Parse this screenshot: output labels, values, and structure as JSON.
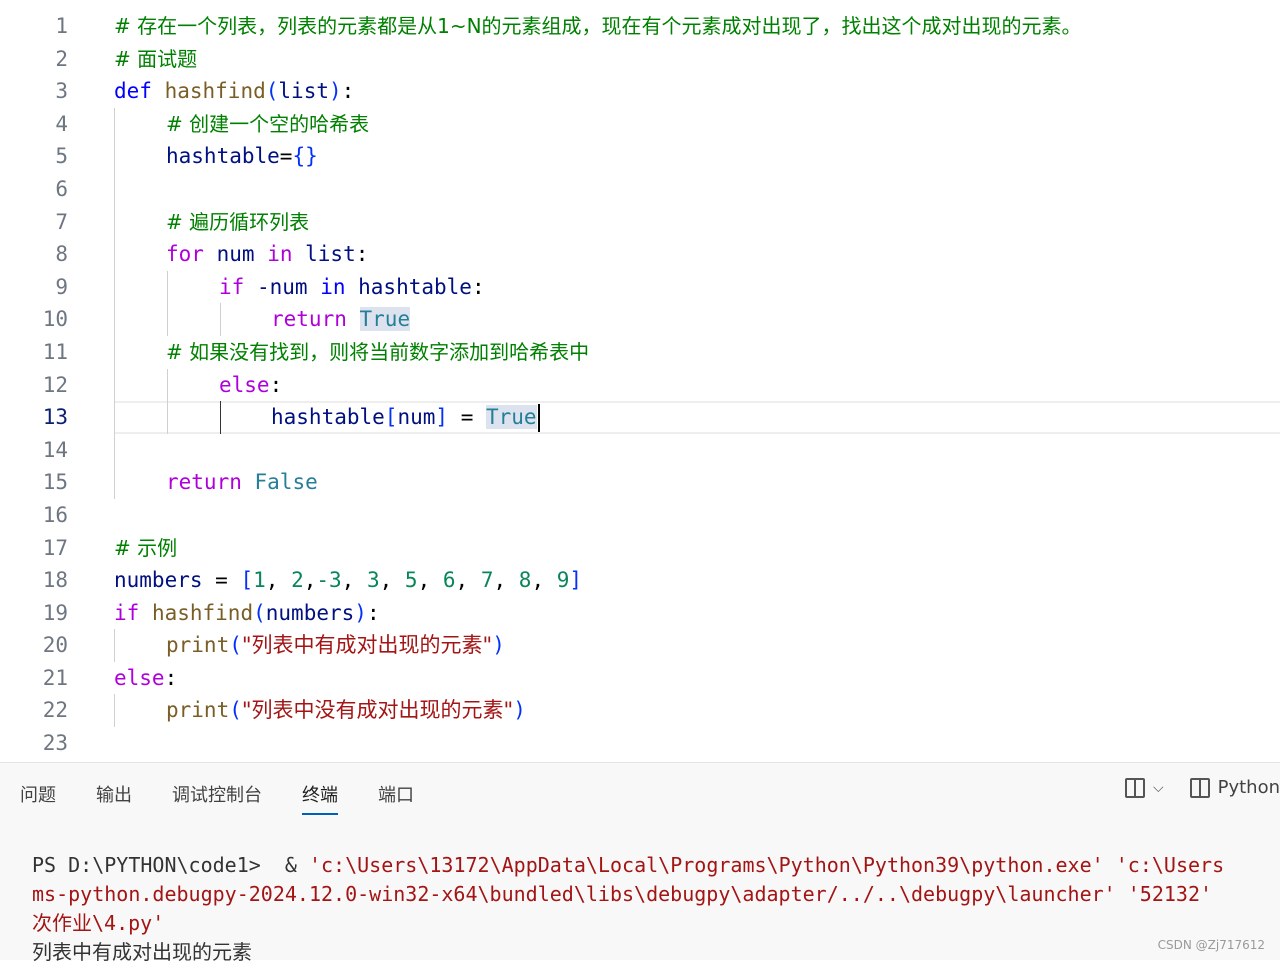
{
  "editor": {
    "active_line": 13,
    "line_numbers": [
      "1",
      "2",
      "3",
      "4",
      "5",
      "6",
      "7",
      "8",
      "9",
      "10",
      "11",
      "12",
      "13",
      "14",
      "15",
      "16",
      "17",
      "18",
      "19",
      "20",
      "21",
      "22",
      "23"
    ],
    "l1_comment": "# 存在一个列表，列表的元素都是从1~N的元素组成，现在有个元素成对出现了，找出这个成对出现的元素。",
    "l2_comment": "# 面试题",
    "l3_def": "def",
    "l3_fn": "hashfind",
    "l3_param": "list",
    "l4_comment": "# 创建一个空的哈希表",
    "l5_var": "hashtable",
    "l7_comment": "# 遍历循环列表",
    "l8_for": "for",
    "l8_var": "num",
    "l8_in": "in",
    "l8_iter": "list",
    "l9_if": "if",
    "l9_expr": "-num",
    "l9_in": "in",
    "l9_target": "hashtable",
    "l10_return": "return",
    "l10_value": "True",
    "l11_comment": "# 如果没有找到，则将当前数字添加到哈希表中",
    "l12_else": "else",
    "l13_target": "hashtable",
    "l13_index": "num",
    "l13_value": "True",
    "l15_return": "return",
    "l15_value": "False",
    "l17_comment": "# 示例",
    "l18_var": "numbers",
    "l18_list": [
      "1",
      "2",
      "-3",
      "3",
      "5",
      "6",
      "7",
      "8",
      "9"
    ],
    "l19_if": "if",
    "l19_fn": "hashfind",
    "l19_arg": "numbers",
    "l20_fn": "print",
    "l20_str": "\"列表中有成对出现的元素\"",
    "l21_else": "else",
    "l22_fn": "print",
    "l22_str": "\"列表中没有成对出现的元素\""
  },
  "panel": {
    "tabs": [
      "问题",
      "输出",
      "调试控制台",
      "终端",
      "端口"
    ],
    "active_tab": "终端",
    "layout_icon": "split-panel-icon",
    "terminal_profile": "Python"
  },
  "terminal": {
    "prompt": "PS D:\\PYTHON\\code1>",
    "amp": "&",
    "exe": "'c:\\Users\\13172\\AppData\\Local\\Programs\\Python\\Python39\\python.exe'",
    "arg1": "'c:\\Users",
    "line2_path": "ms-python.debugpy-2024.12.0-win32-x64\\bundled\\libs\\debugpy\\adapter/../..\\debugpy\\launcher'",
    "line2_port": "'52132'",
    "line3_prefix": "次作业",
    "line3_file": "\\4.py'",
    "output": "列表中有成对出现的元素"
  },
  "watermark": "CSDN @Zj717612"
}
